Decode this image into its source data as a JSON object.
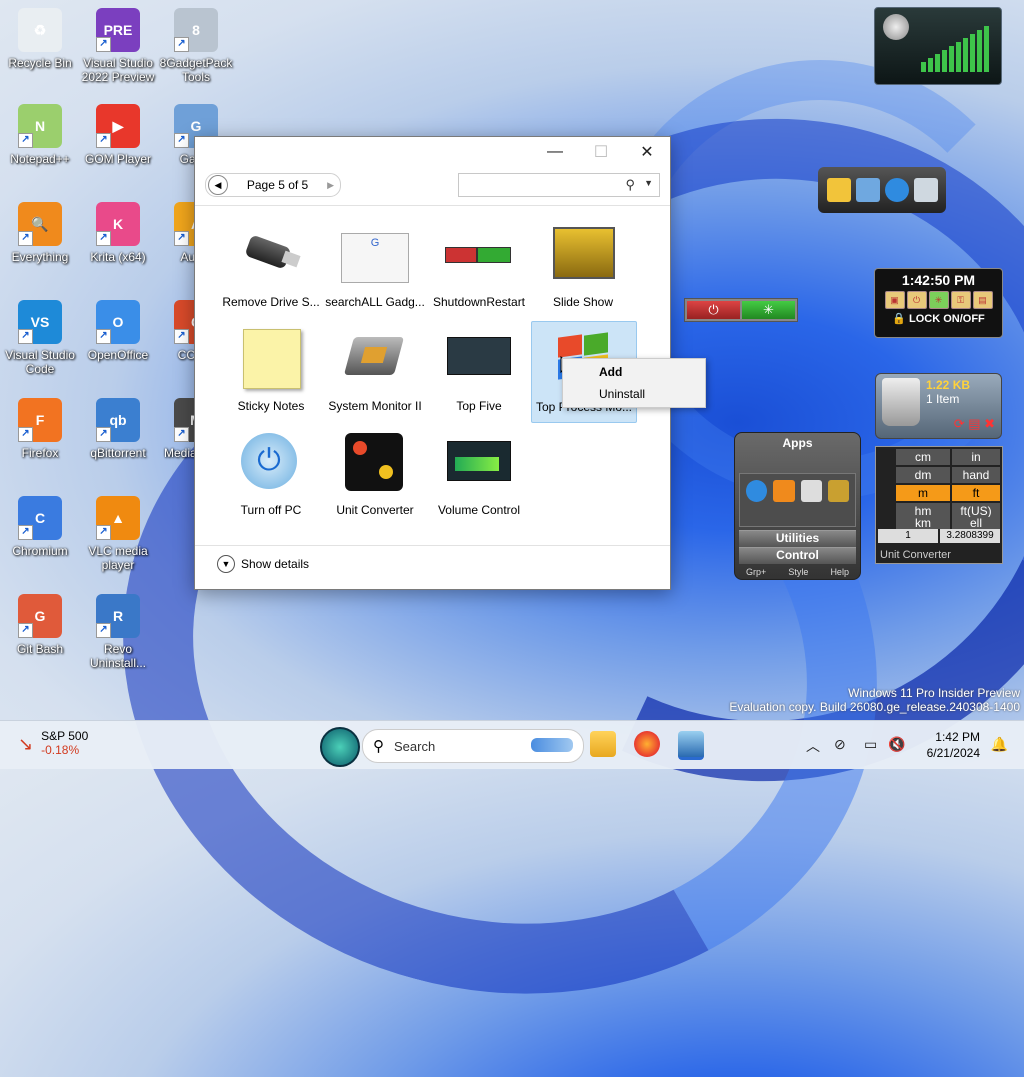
{
  "desktop": {
    "icons": [
      {
        "label": "Recycle Bin",
        "color": "#e9eef2",
        "glyph": "♻"
      },
      {
        "label": "Visual Studio 2022 Preview",
        "color": "#7b3fbf",
        "glyph": "PRE"
      },
      {
        "label": "8GadgetPack Tools",
        "color": "#b9c4d0",
        "glyph": "8"
      },
      {
        "label": "Notepad++",
        "color": "#9bcf6d",
        "glyph": "N"
      },
      {
        "label": "GOM Player",
        "color": "#e8372b",
        "glyph": "▶"
      },
      {
        "label": "Gad...",
        "color": "#6fa0d8",
        "glyph": "G"
      },
      {
        "label": "Everything",
        "color": "#f08a1c",
        "glyph": "🔍"
      },
      {
        "label": "Krita (x64)",
        "color": "#e94a8a",
        "glyph": "K"
      },
      {
        "label": "Aud...",
        "color": "#f0a51c",
        "glyph": "A"
      },
      {
        "label": "Visual Studio Code",
        "color": "#1e8ad8",
        "glyph": "VS"
      },
      {
        "label": "OpenOffice",
        "color": "#3a8ee8",
        "glyph": "O"
      },
      {
        "label": "CCle...",
        "color": "#d84a2a",
        "glyph": "C"
      },
      {
        "label": "Firefox",
        "color": "#f27321",
        "glyph": "F"
      },
      {
        "label": "qBittorrent",
        "color": "#3b7fd0",
        "glyph": "qb"
      },
      {
        "label": "Media Cla...",
        "color": "#4a4a4a",
        "glyph": "M"
      },
      {
        "label": "Chromium",
        "color": "#3a7be0",
        "glyph": "C"
      },
      {
        "label": "VLC media player",
        "color": "#f08a10",
        "glyph": "▲"
      },
      {
        "label": "Git Bash",
        "color": "#e05a3a",
        "glyph": "G"
      },
      {
        "label": "Revo Uninstall...",
        "color": "#3a78c8",
        "glyph": "R"
      }
    ]
  },
  "dialog": {
    "pager": "Page 5 of 5",
    "search_placeholder": "",
    "gadgets": [
      {
        "label": "Remove Drive S..."
      },
      {
        "label": "searchALL Gadg..."
      },
      {
        "label": "ShutdownRestart"
      },
      {
        "label": "Slide Show"
      },
      {
        "label": "Sticky Notes"
      },
      {
        "label": "System Monitor II"
      },
      {
        "label": "Top Five"
      },
      {
        "label": "Top Process Mo..."
      },
      {
        "label": "Turn off PC"
      },
      {
        "label": "Unit Converter"
      },
      {
        "label": "Volume Control"
      }
    ],
    "show_details": "Show details"
  },
  "context_menu": {
    "add": "Add",
    "uninstall": "Uninstall"
  },
  "widgets": {
    "clock_time": "1:42:50 PM",
    "lock_label": "LOCK ON/OFF",
    "bin_size": "1.22 KB",
    "bin_items": "1 Item",
    "apps_title": "Apps",
    "apps_utilities": "Utilities",
    "apps_control": "Control",
    "apps_foot": [
      "Grp+",
      "Style",
      "Help"
    ],
    "unit_left": [
      "cm",
      "dm",
      "m",
      "hm",
      "km"
    ],
    "unit_right": [
      "in",
      "hand",
      "ft",
      "ft(US)",
      "ell"
    ],
    "unit_input": "1",
    "unit_output": "3.2808399",
    "unit_title": "Unit Converter"
  },
  "watermark": {
    "line1": "Windows 11 Pro Insider Preview",
    "line2": "Evaluation copy. Build 26080.ge_release.240308-1400"
  },
  "taskbar": {
    "stock_name": "S&P 500",
    "stock_change": "-0.18%",
    "search_label": "Search",
    "time": "1:42 PM",
    "date": "6/21/2024"
  }
}
